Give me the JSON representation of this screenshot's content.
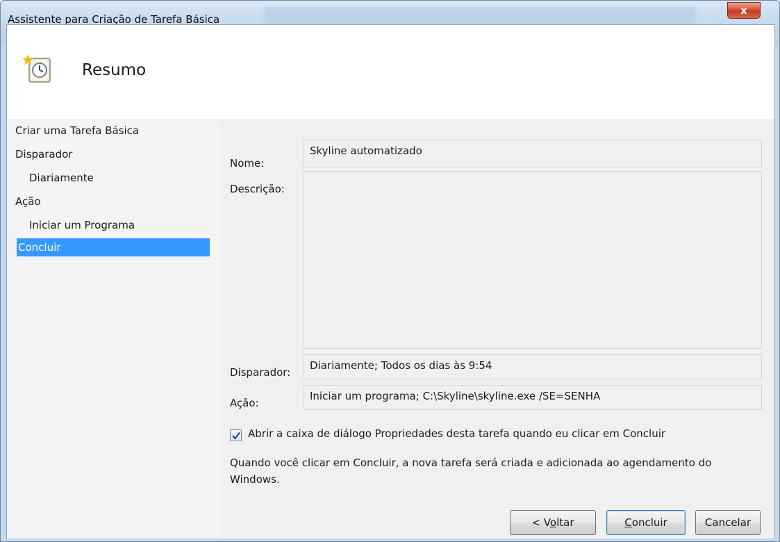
{
  "window": {
    "title": "Assistente para Criação de Tarefa Básica",
    "close_label": "x"
  },
  "header": {
    "title": "Resumo",
    "icon": "scheduled-task-clock-icon"
  },
  "steps": [
    {
      "label": "Criar uma Tarefa Básica",
      "selected": false,
      "indent": 0
    },
    {
      "label": "Disparador",
      "selected": false,
      "indent": 0
    },
    {
      "label": "Diariamente",
      "selected": false,
      "indent": 1
    },
    {
      "label": "Ação",
      "selected": false,
      "indent": 0
    },
    {
      "label": "Iniciar um Programa",
      "selected": false,
      "indent": 1
    },
    {
      "label": "Concluir",
      "selected": true,
      "indent": 0
    }
  ],
  "summary": {
    "name_label": "Nome:",
    "name_value": "Skyline automatizado",
    "description_label": "Descrição:",
    "description_value": "",
    "trigger_label": "Disparador:",
    "trigger_value": "Diariamente; Todos os dias às 9:54",
    "action_label": "Ação:",
    "action_value": "Iniciar um programa; C:\\Skyline\\skyline.exe /SE=SENHA"
  },
  "open_properties": {
    "checked": true,
    "label": "Abrir a caixa de diálogo Propriedades desta tarefa quando eu clicar em Concluir"
  },
  "info_text": "Quando você clicar em Concluir, a nova tarefa será criada e adicionada ao agendamento do Windows.",
  "buttons": {
    "back_prefix": "< V",
    "back_mnemonic": "o",
    "back_suffix": "ltar",
    "finish_mnemonic": "C",
    "finish_suffix": "oncluir",
    "cancel_label": "Cancelar"
  },
  "colors": {
    "selection": "#3399ff",
    "close_button": "#c43b20"
  }
}
